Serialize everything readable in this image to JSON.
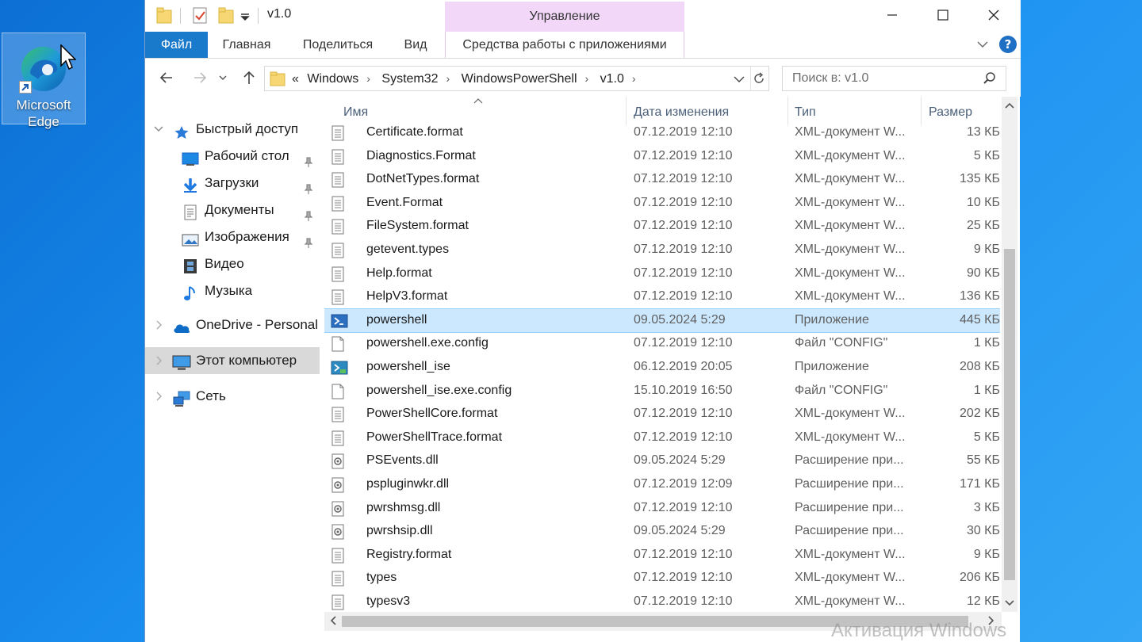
{
  "desktop": {
    "icon_label_line1": "Microsoft",
    "icon_label_line2": "Edge"
  },
  "window": {
    "title": "v1.0",
    "manage_tab": "Управление",
    "controls": {
      "minimize": "—",
      "maximize": "☐",
      "close": "✕"
    }
  },
  "ribbon": {
    "tabs": [
      {
        "label": "Файл"
      },
      {
        "label": "Главная"
      },
      {
        "label": "Поделиться"
      },
      {
        "label": "Вид"
      },
      {
        "label": "Средства работы с приложениями"
      }
    ]
  },
  "address": {
    "prefix": "«",
    "crumbs": [
      "Windows",
      "System32",
      "WindowsPowerShell",
      "v1.0"
    ]
  },
  "search": {
    "placeholder": "Поиск в: v1.0"
  },
  "nav": {
    "items": [
      {
        "label": "Быстрый доступ"
      },
      {
        "label": "Рабочий стол"
      },
      {
        "label": "Загрузки"
      },
      {
        "label": "Документы"
      },
      {
        "label": "Изображения"
      },
      {
        "label": "Видео"
      },
      {
        "label": "Музыка"
      },
      {
        "label": "OneDrive - Personal"
      },
      {
        "label": "Этот компьютер"
      },
      {
        "label": "Сеть"
      }
    ]
  },
  "columns": {
    "name": "Имя",
    "date": "Дата изменения",
    "type": "Тип",
    "size": "Размер"
  },
  "files": [
    {
      "name": "Certificate.format",
      "date": "07.12.2019 12:10",
      "type": "XML-документ W...",
      "size": "13 КБ",
      "icon": "xml"
    },
    {
      "name": "Diagnostics.Format",
      "date": "07.12.2019 12:10",
      "type": "XML-документ W...",
      "size": "5 КБ",
      "icon": "xml"
    },
    {
      "name": "DotNetTypes.format",
      "date": "07.12.2019 12:10",
      "type": "XML-документ W...",
      "size": "135 КБ",
      "icon": "xml"
    },
    {
      "name": "Event.Format",
      "date": "07.12.2019 12:10",
      "type": "XML-документ W...",
      "size": "10 КБ",
      "icon": "xml"
    },
    {
      "name": "FileSystem.format",
      "date": "07.12.2019 12:10",
      "type": "XML-документ W...",
      "size": "25 КБ",
      "icon": "xml"
    },
    {
      "name": "getevent.types",
      "date": "07.12.2019 12:10",
      "type": "XML-документ W...",
      "size": "9 КБ",
      "icon": "xml"
    },
    {
      "name": "Help.format",
      "date": "07.12.2019 12:10",
      "type": "XML-документ W...",
      "size": "90 КБ",
      "icon": "xml"
    },
    {
      "name": "HelpV3.format",
      "date": "07.12.2019 12:10",
      "type": "XML-документ W...",
      "size": "136 КБ",
      "icon": "xml"
    },
    {
      "name": "powershell",
      "date": "09.05.2024 5:29",
      "type": "Приложение",
      "size": "445 КБ",
      "icon": "ps",
      "selected": true
    },
    {
      "name": "powershell.exe.config",
      "date": "07.12.2019 12:10",
      "type": "Файл \"CONFIG\"",
      "size": "1 КБ",
      "icon": "blank"
    },
    {
      "name": "powershell_ise",
      "date": "06.12.2019 20:05",
      "type": "Приложение",
      "size": "208 КБ",
      "icon": "ise"
    },
    {
      "name": "powershell_ise.exe.config",
      "date": "15.10.2019 16:50",
      "type": "Файл \"CONFIG\"",
      "size": "1 КБ",
      "icon": "blank"
    },
    {
      "name": "PowerShellCore.format",
      "date": "07.12.2019 12:10",
      "type": "XML-документ W...",
      "size": "202 КБ",
      "icon": "xml"
    },
    {
      "name": "PowerShellTrace.format",
      "date": "07.12.2019 12:10",
      "type": "XML-документ W...",
      "size": "5 КБ",
      "icon": "xml"
    },
    {
      "name": "PSEvents.dll",
      "date": "09.05.2024 5:29",
      "type": "Расширение при...",
      "size": "55 КБ",
      "icon": "dll"
    },
    {
      "name": "pspluginwkr.dll",
      "date": "07.12.2019 12:09",
      "type": "Расширение при...",
      "size": "171 КБ",
      "icon": "dll"
    },
    {
      "name": "pwrshmsg.dll",
      "date": "07.12.2019 12:10",
      "type": "Расширение при...",
      "size": "3 КБ",
      "icon": "dll"
    },
    {
      "name": "pwrshsip.dll",
      "date": "09.05.2024 5:29",
      "type": "Расширение при...",
      "size": "30 КБ",
      "icon": "dll"
    },
    {
      "name": "Registry.format",
      "date": "07.12.2019 12:10",
      "type": "XML-документ W...",
      "size": "9 КБ",
      "icon": "xml"
    },
    {
      "name": "types",
      "date": "07.12.2019 12:10",
      "type": "XML-документ W...",
      "size": "206 КБ",
      "icon": "xml"
    },
    {
      "name": "typesv3",
      "date": "07.12.2019 12:10",
      "type": "XML-документ W...",
      "size": "12 КБ",
      "icon": "xml"
    }
  ],
  "watermark": "Активация Windows"
}
